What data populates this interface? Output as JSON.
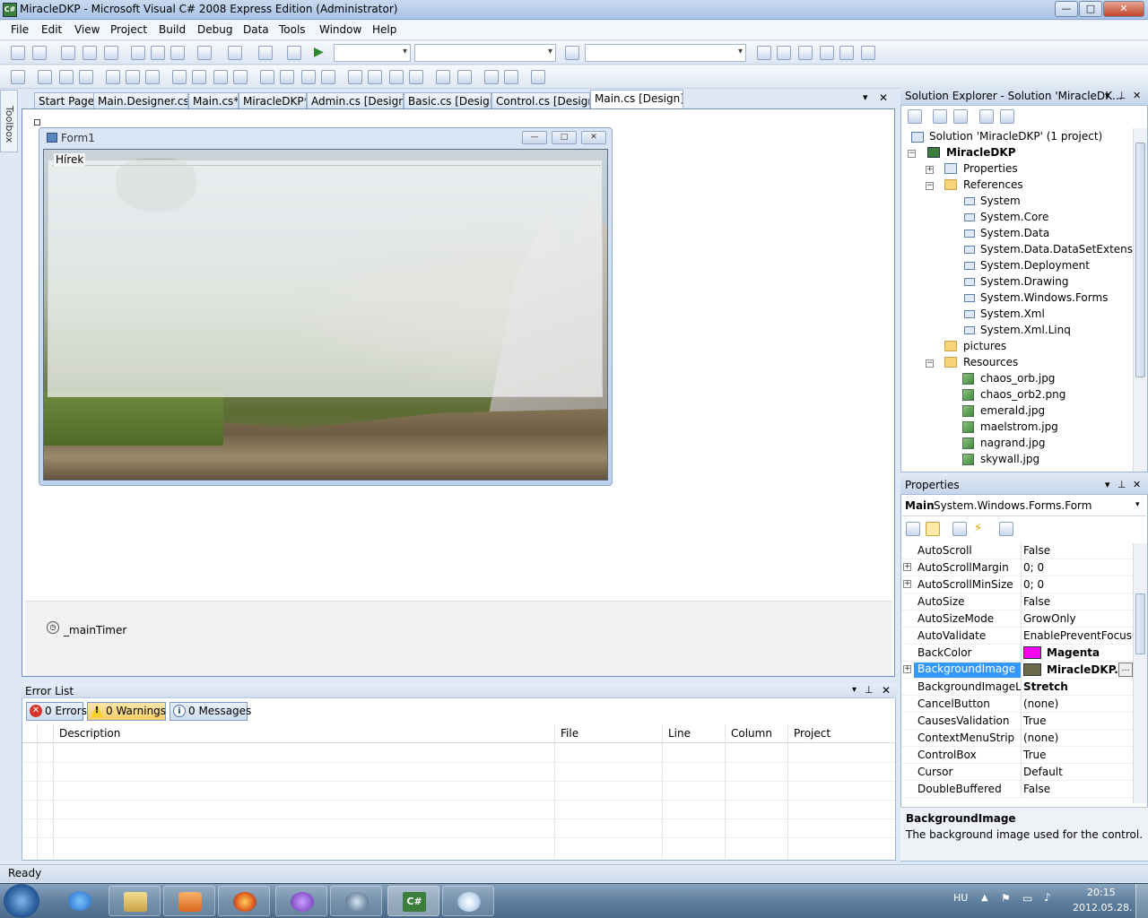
{
  "window": {
    "title": "MiracleDKP - Microsoft Visual C# 2008 Express Edition (Administrator)",
    "icon_text": "C#",
    "minimize": "—",
    "maximize": "□",
    "close": "✕"
  },
  "menu": [
    "File",
    "Edit",
    "View",
    "Project",
    "Build",
    "Debug",
    "Data",
    "Tools",
    "Window",
    "Help"
  ],
  "toolbox": {
    "label": "Toolbox"
  },
  "doc_tabs": [
    {
      "label": "Start Page"
    },
    {
      "label": "Main.Designer.cs*"
    },
    {
      "label": "Main.cs*"
    },
    {
      "label": "MiracleDKP*"
    },
    {
      "label": "Admin.cs [Design]"
    },
    {
      "label": "Basic.cs [Design]"
    },
    {
      "label": "Control.cs [Design]"
    },
    {
      "label": "Main.cs [Design]*"
    }
  ],
  "doc_tabs_controls": {
    "dropdown": "▾",
    "close": "✕"
  },
  "form": {
    "title": "Form1",
    "groupbox_label": "Hírek",
    "min": "—",
    "max": "□",
    "close": "✕"
  },
  "component_tray": {
    "timer_label": "_mainTimer"
  },
  "error_list": {
    "title": "Error List",
    "errors": "0 Errors",
    "warnings": "0 Warnings",
    "messages": "0 Messages",
    "columns": [
      "Description",
      "File",
      "Line",
      "Column",
      "Project"
    ]
  },
  "solution_explorer": {
    "title": "Solution Explorer - Solution 'MiracleDK...",
    "pin": "📌",
    "close": "✕",
    "tree": {
      "solution": "Solution 'MiracleDKP' (1 project)",
      "project": "MiracleDKP",
      "properties": "Properties",
      "references": "References",
      "refs": [
        "System",
        "System.Core",
        "System.Data",
        "System.Data.DataSetExtensions",
        "System.Deployment",
        "System.Drawing",
        "System.Windows.Forms",
        "System.Xml",
        "System.Xml.Linq"
      ],
      "pictures": "pictures",
      "resources": "Resources",
      "resource_files": [
        "chaos_orb.jpg",
        "chaos_orb2.png",
        "emerald.jpg",
        "maelstrom.jpg",
        "nagrand.jpg",
        "skywall.jpg"
      ]
    }
  },
  "properties": {
    "title": "Properties",
    "object_name": "Main",
    "object_type": "System.Windows.Forms.Form",
    "rows": [
      {
        "name": "AutoScroll",
        "value": "False",
        "expandable": false
      },
      {
        "name": "AutoScrollMargin",
        "value": "0; 0",
        "expandable": true
      },
      {
        "name": "AutoScrollMinSize",
        "value": "0; 0",
        "expandable": true
      },
      {
        "name": "AutoSize",
        "value": "False",
        "expandable": false
      },
      {
        "name": "AutoSizeMode",
        "value": "GrowOnly",
        "expandable": false
      },
      {
        "name": "AutoValidate",
        "value": "EnablePreventFocusCh",
        "expandable": false
      },
      {
        "name": "BackColor",
        "value": "Magenta",
        "expandable": false,
        "bold": true,
        "swatch": "#ff00ff"
      },
      {
        "name": "BackgroundImage",
        "value": "MiracleDKP.Pr",
        "expandable": true,
        "bold": true,
        "selected": true,
        "swatch": "#6b6a4c"
      },
      {
        "name": "BackgroundImageLay",
        "value": "Stretch",
        "expandable": false,
        "bold": true
      },
      {
        "name": "CancelButton",
        "value": "(none)",
        "expandable": false
      },
      {
        "name": "CausesValidation",
        "value": "True",
        "expandable": false
      },
      {
        "name": "ContextMenuStrip",
        "value": "(none)",
        "expandable": false
      },
      {
        "name": "ControlBox",
        "value": "True",
        "expandable": false
      },
      {
        "name": "Cursor",
        "value": "Default",
        "expandable": false
      },
      {
        "name": "DoubleBuffered",
        "value": "False",
        "expandable": false
      }
    ],
    "description_title": "BackgroundImage",
    "description_text": "The background image used for the control."
  },
  "status": {
    "text": "Ready"
  },
  "taskbar": {
    "language": "HU",
    "time": "20:15",
    "date": "2012.05.28."
  },
  "colors": {
    "selected_row": "#3399ff",
    "backcolor_swatch": "#ff00ff",
    "accent": "#6d8fc7"
  }
}
